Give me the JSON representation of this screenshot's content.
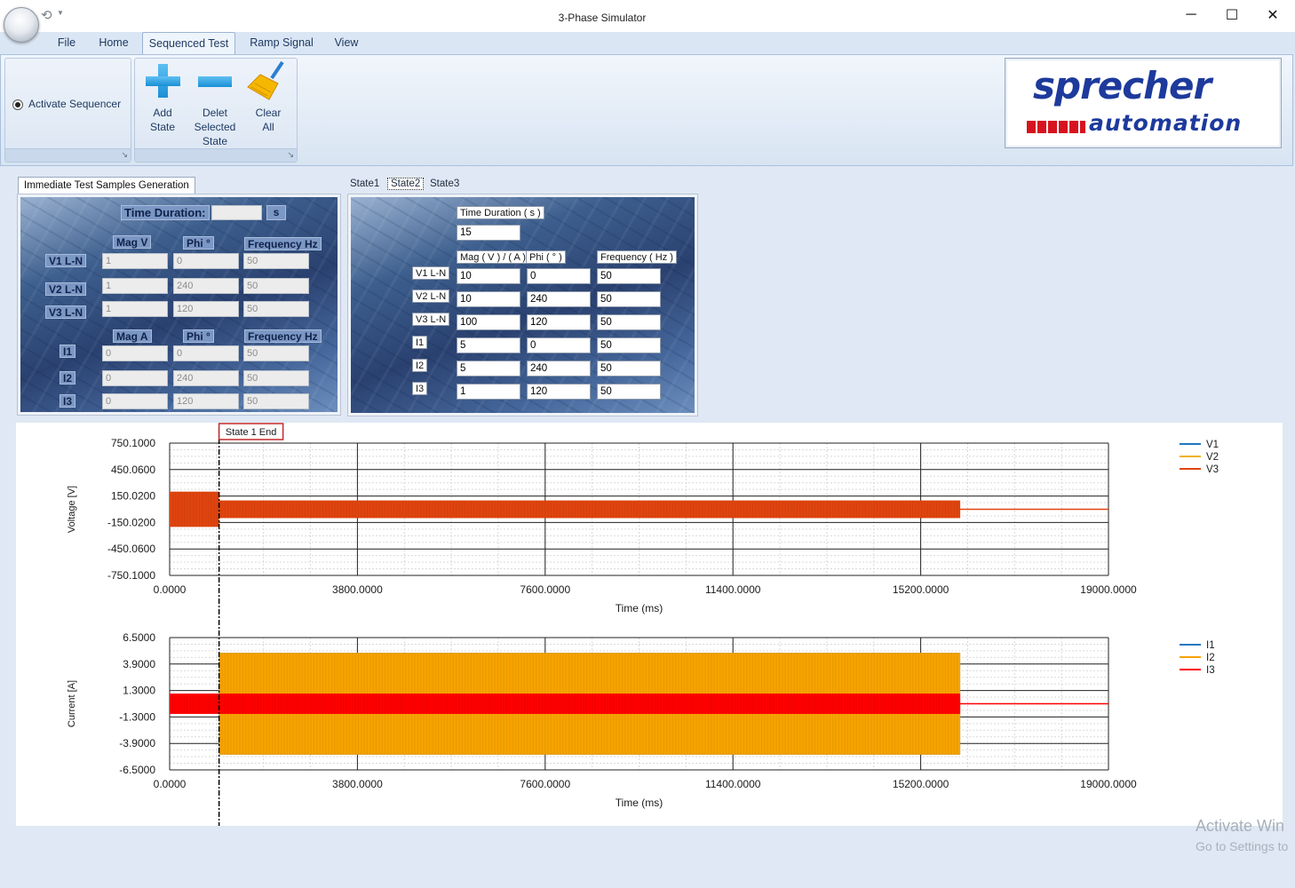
{
  "window": {
    "title": "3-Phase Simulator",
    "minimize": "─",
    "maximize": "☐",
    "close": "✕"
  },
  "menu": [
    "File",
    "Home",
    "Sequenced Test",
    "Ramp Signal",
    "View"
  ],
  "ribbon": {
    "activate_sequencer": "Activate Sequencer",
    "add_state": [
      "Add",
      "State"
    ],
    "delete_state": [
      "Delet",
      "Selected",
      "State"
    ],
    "clear_all": [
      "Clear",
      "All"
    ]
  },
  "logo": {
    "line1": "sprecher",
    "line2": "automation"
  },
  "immediate": {
    "tab": "Immediate Test Samples Generation",
    "time_duration_label": "Time Duration:",
    "time_duration_value": "",
    "unit": "s",
    "voltage_headers": [
      "Mag V",
      "Phi °",
      "Frequency Hz"
    ],
    "current_headers": [
      "Mag A",
      "Phi °",
      "Frequency Hz"
    ],
    "rows": [
      {
        "label": "V1 L-N",
        "mag": "1",
        "phi": "0",
        "freq": "50"
      },
      {
        "label": "V2 L-N",
        "mag": "1",
        "phi": "240",
        "freq": "50"
      },
      {
        "label": "V3 L-N",
        "mag": "1",
        "phi": "120",
        "freq": "50"
      },
      {
        "label": "I1",
        "mag": "0",
        "phi": "0",
        "freq": "50"
      },
      {
        "label": "I2",
        "mag": "0",
        "phi": "240",
        "freq": "50"
      },
      {
        "label": "I3",
        "mag": "0",
        "phi": "120",
        "freq": "50"
      }
    ]
  },
  "states": {
    "tabs": [
      "State1",
      "State2",
      "State3"
    ],
    "selected_tab": "State2",
    "time_duration_label": "Time Duration ( s )",
    "time_duration_value": "15",
    "headers": [
      "Mag ( V ) / ( A )",
      "Phi ( ° )",
      "Frequency ( Hz )"
    ],
    "rows": [
      {
        "label": "V1 L-N",
        "mag": "10",
        "phi": "0",
        "freq": "50"
      },
      {
        "label": "V2 L-N",
        "mag": "10",
        "phi": "240",
        "freq": "50"
      },
      {
        "label": "V3 L-N",
        "mag": "100",
        "phi": "120",
        "freq": "50"
      },
      {
        "label": "I1",
        "mag": "5",
        "phi": "0",
        "freq": "50"
      },
      {
        "label": "I2",
        "mag": "5",
        "phi": "240",
        "freq": "50"
      },
      {
        "label": "I3",
        "mag": "1",
        "phi": "120",
        "freq": "50"
      }
    ]
  },
  "marker": {
    "label": "State 1 End",
    "time_ms": 1000
  },
  "chart_data": [
    {
      "type": "area",
      "title": "",
      "xlabel": "Time (ms)",
      "ylabel": "Voltage [V]",
      "xlim": [
        0,
        19000
      ],
      "ylim": [
        -750.1,
        750.1
      ],
      "xticks": [
        "0.0000",
        "3800.0000",
        "7600.0000",
        "11400.0000",
        "15200.0000",
        "19000.0000"
      ],
      "yticks": [
        "750.1000",
        "450.0600",
        "150.0200",
        "-150.0200",
        "-450.0600",
        "-750.1000"
      ],
      "legend": "top-right",
      "series": [
        {
          "name": "V1",
          "color": "#1f77c4",
          "segments": [
            {
              "t0": 0,
              "t1": 1000,
              "amp": 1
            },
            {
              "t0": 1000,
              "t1": 16000,
              "amp": 10
            }
          ]
        },
        {
          "name": "V2",
          "color": "#f0b020",
          "segments": [
            {
              "t0": 0,
              "t1": 1000,
              "amp": 1
            },
            {
              "t0": 1000,
              "t1": 16000,
              "amp": 10
            }
          ]
        },
        {
          "name": "V3",
          "color": "#e0440e",
          "segments": [
            {
              "t0": 0,
              "t1": 1000,
              "amp": 200
            },
            {
              "t0": 1000,
              "t1": 16000,
              "amp": 100
            }
          ]
        }
      ],
      "tail": {
        "t0": 16000,
        "t1": 19000,
        "value": 0,
        "color": "#e0440e"
      }
    },
    {
      "type": "area",
      "title": "",
      "xlabel": "Time (ms)",
      "ylabel": "Current [A]",
      "xlim": [
        0,
        19000
      ],
      "ylim": [
        -6.5,
        6.5
      ],
      "xticks": [
        "0.0000",
        "3800.0000",
        "7600.0000",
        "11400.0000",
        "15200.0000",
        "19000.0000"
      ],
      "yticks": [
        "6.5000",
        "3.9000",
        "1.3000",
        "-1.3000",
        "-3.9000",
        "-6.5000"
      ],
      "legend": "top-right",
      "series": [
        {
          "name": "I1",
          "color": "#1f77c4",
          "segments": [
            {
              "t0": 1000,
              "t1": 16000,
              "amp": 5
            }
          ]
        },
        {
          "name": "I2",
          "color": "#f7a300",
          "segments": [
            {
              "t0": 1000,
              "t1": 16000,
              "amp": 5
            }
          ]
        },
        {
          "name": "I3",
          "color": "#ff0000",
          "segments": [
            {
              "t0": 0,
              "t1": 1000,
              "amp": 1
            },
            {
              "t0": 1000,
              "t1": 16000,
              "amp": 1
            }
          ]
        }
      ],
      "tail": {
        "t0": 16000,
        "t1": 19000,
        "value": 0,
        "color": "#ff0000"
      }
    }
  ],
  "watermark": {
    "line1": "Activate Win",
    "line2": "Go to Settings to"
  }
}
